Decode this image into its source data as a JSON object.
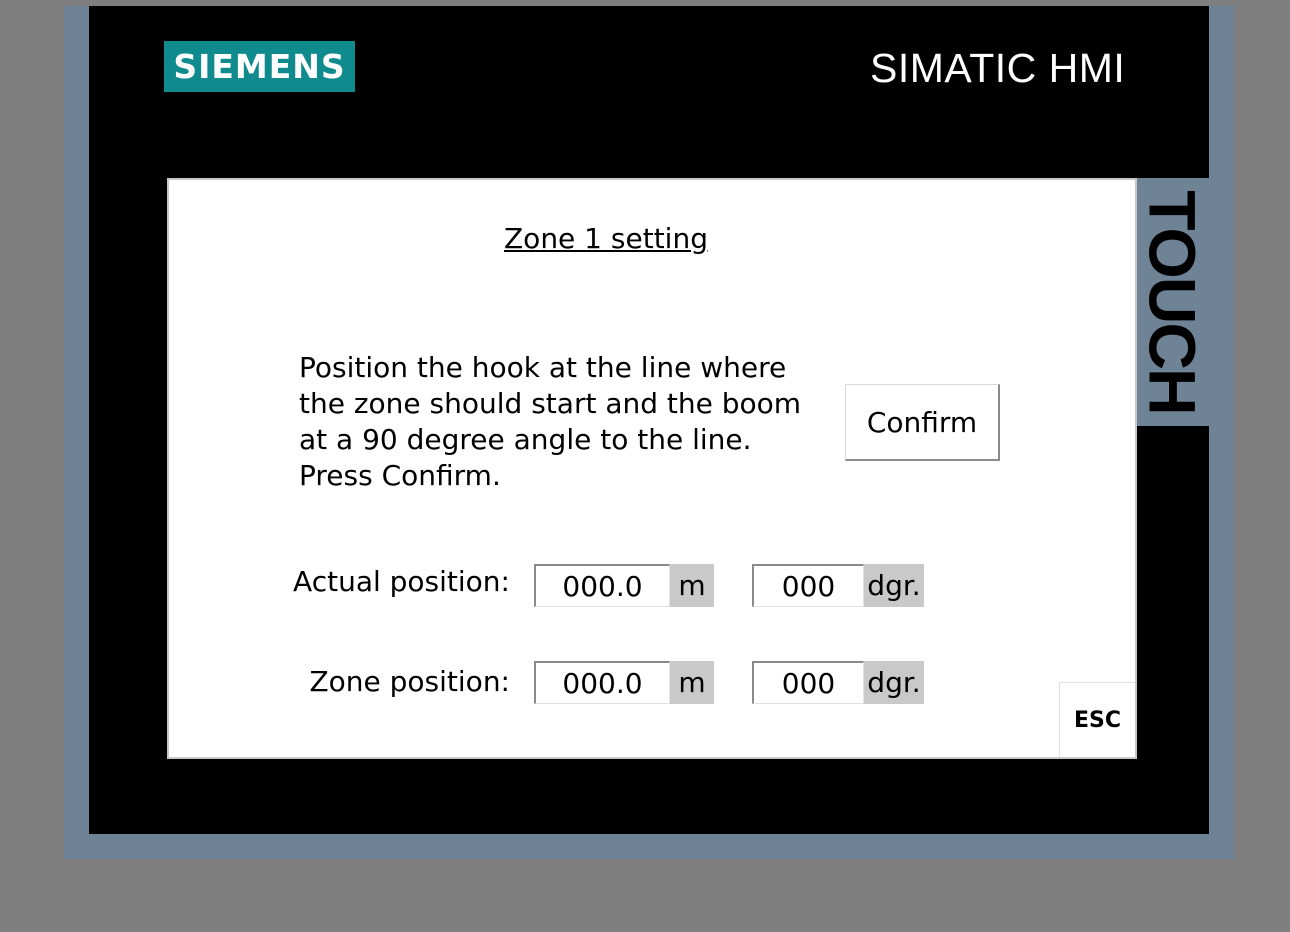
{
  "header": {
    "brand_logo_text": "SIEMENS",
    "product_label": "SIMATIC HMI",
    "side_label": "TOUCH"
  },
  "screen": {
    "title": "Zone 1 setting",
    "instructions": [
      "Position the hook at the line where",
      "the zone should start and the boom",
      "at a 90 degree angle to the line.",
      "Press Confirm."
    ],
    "confirm_label": "Confirm",
    "actual_position": {
      "label": "Actual position:",
      "distance_value": "000.0",
      "distance_unit": "m",
      "angle_value": "000",
      "angle_unit": "dgr."
    },
    "zone_position": {
      "label": "Zone position:",
      "distance_value": "000.0",
      "distance_unit": "m",
      "angle_value": "000",
      "angle_unit": "dgr."
    },
    "esc_label": "ESC"
  },
  "colors": {
    "bezel": "#6f8396",
    "brand": "#0f8b8d",
    "unit_background": "#c9c9c9"
  }
}
